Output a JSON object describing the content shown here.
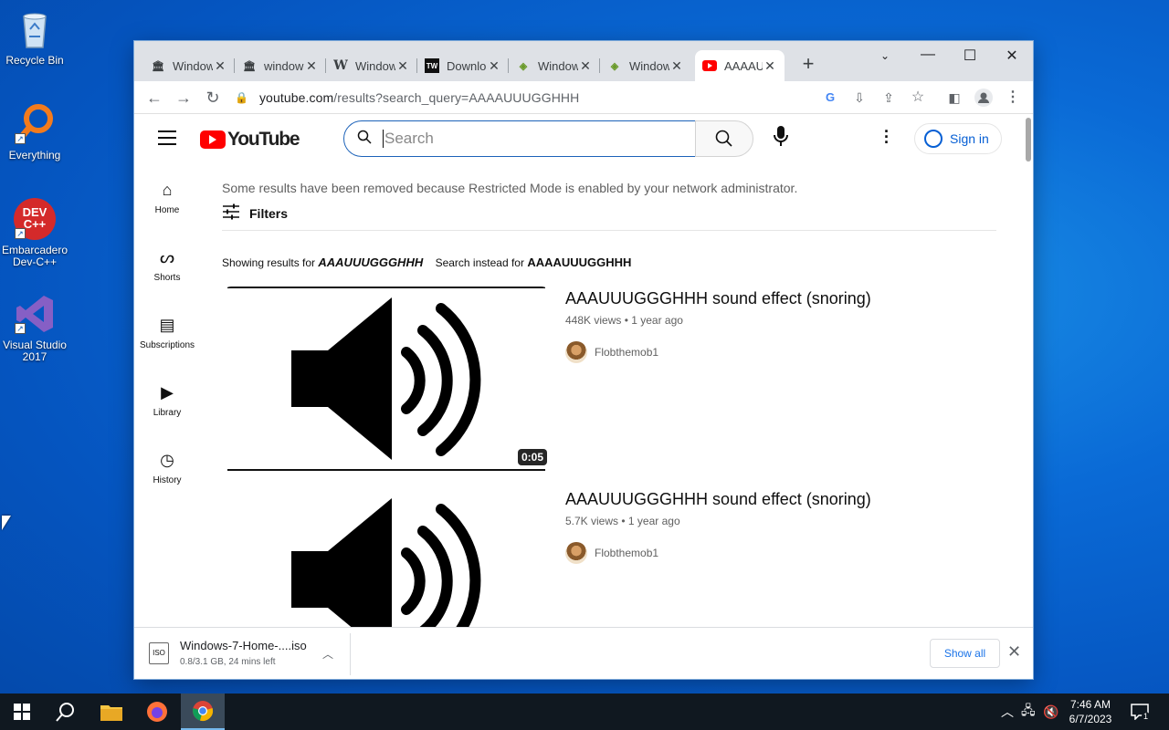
{
  "desktop": {
    "icons": [
      {
        "label": "Recycle Bin"
      },
      {
        "label": "Everything"
      },
      {
        "label": "Embarcadero Dev-C++",
        "logo_text": "DEV C++"
      },
      {
        "label": "Visual Studio 2017"
      }
    ]
  },
  "browser": {
    "tabs": [
      {
        "title": "Windows",
        "close": "✕"
      },
      {
        "title": "windows",
        "close": "✕"
      },
      {
        "title": "Windows",
        "close": "✕"
      },
      {
        "title": "Download",
        "close": "✕"
      },
      {
        "title": "Windows",
        "close": "✕"
      },
      {
        "title": "Windows",
        "close": "✕"
      },
      {
        "title": "AAAAUUUGGHHH",
        "close": "✕"
      }
    ],
    "new_tab": "+",
    "address": {
      "host": "youtube.com",
      "path": "/results?search_query=AAAAUUUGGHHH"
    }
  },
  "youtube": {
    "logo": "YouTube",
    "search_placeholder": "Search",
    "signin": "Sign in",
    "guide": [
      {
        "label": "Home"
      },
      {
        "label": "Shorts"
      },
      {
        "label": "Subscriptions"
      },
      {
        "label": "Library"
      },
      {
        "label": "History"
      }
    ],
    "notice": "Some results have been removed because Restricted Mode is enabled by your network administrator.",
    "filters": "Filters",
    "showing_prefix": "Showing results for",
    "showing_query": "AAAUUUGGGHHH",
    "instead_prefix": "Search instead for",
    "instead_query": "AAAAUUUGGHHH",
    "results": [
      {
        "title": "AAAUUUGGGHHH sound effect (snoring)",
        "views": "448K views",
        "age": "1 year ago",
        "channel": "Flobthemob1",
        "duration": "0:05"
      },
      {
        "title": "AAAUUUGGGHHH sound effect (snoring)",
        "views": "5.7K views",
        "age": "1 year ago",
        "channel": "Flobthemob1",
        "duration": ""
      }
    ]
  },
  "download": {
    "filename": "Windows-7-Home-....iso",
    "status": "0.8/3.1 GB, 24 mins left",
    "show_all": "Show all"
  },
  "taskbar": {
    "time": "7:46 AM",
    "date": "6/7/2023",
    "notif_count": "1"
  }
}
